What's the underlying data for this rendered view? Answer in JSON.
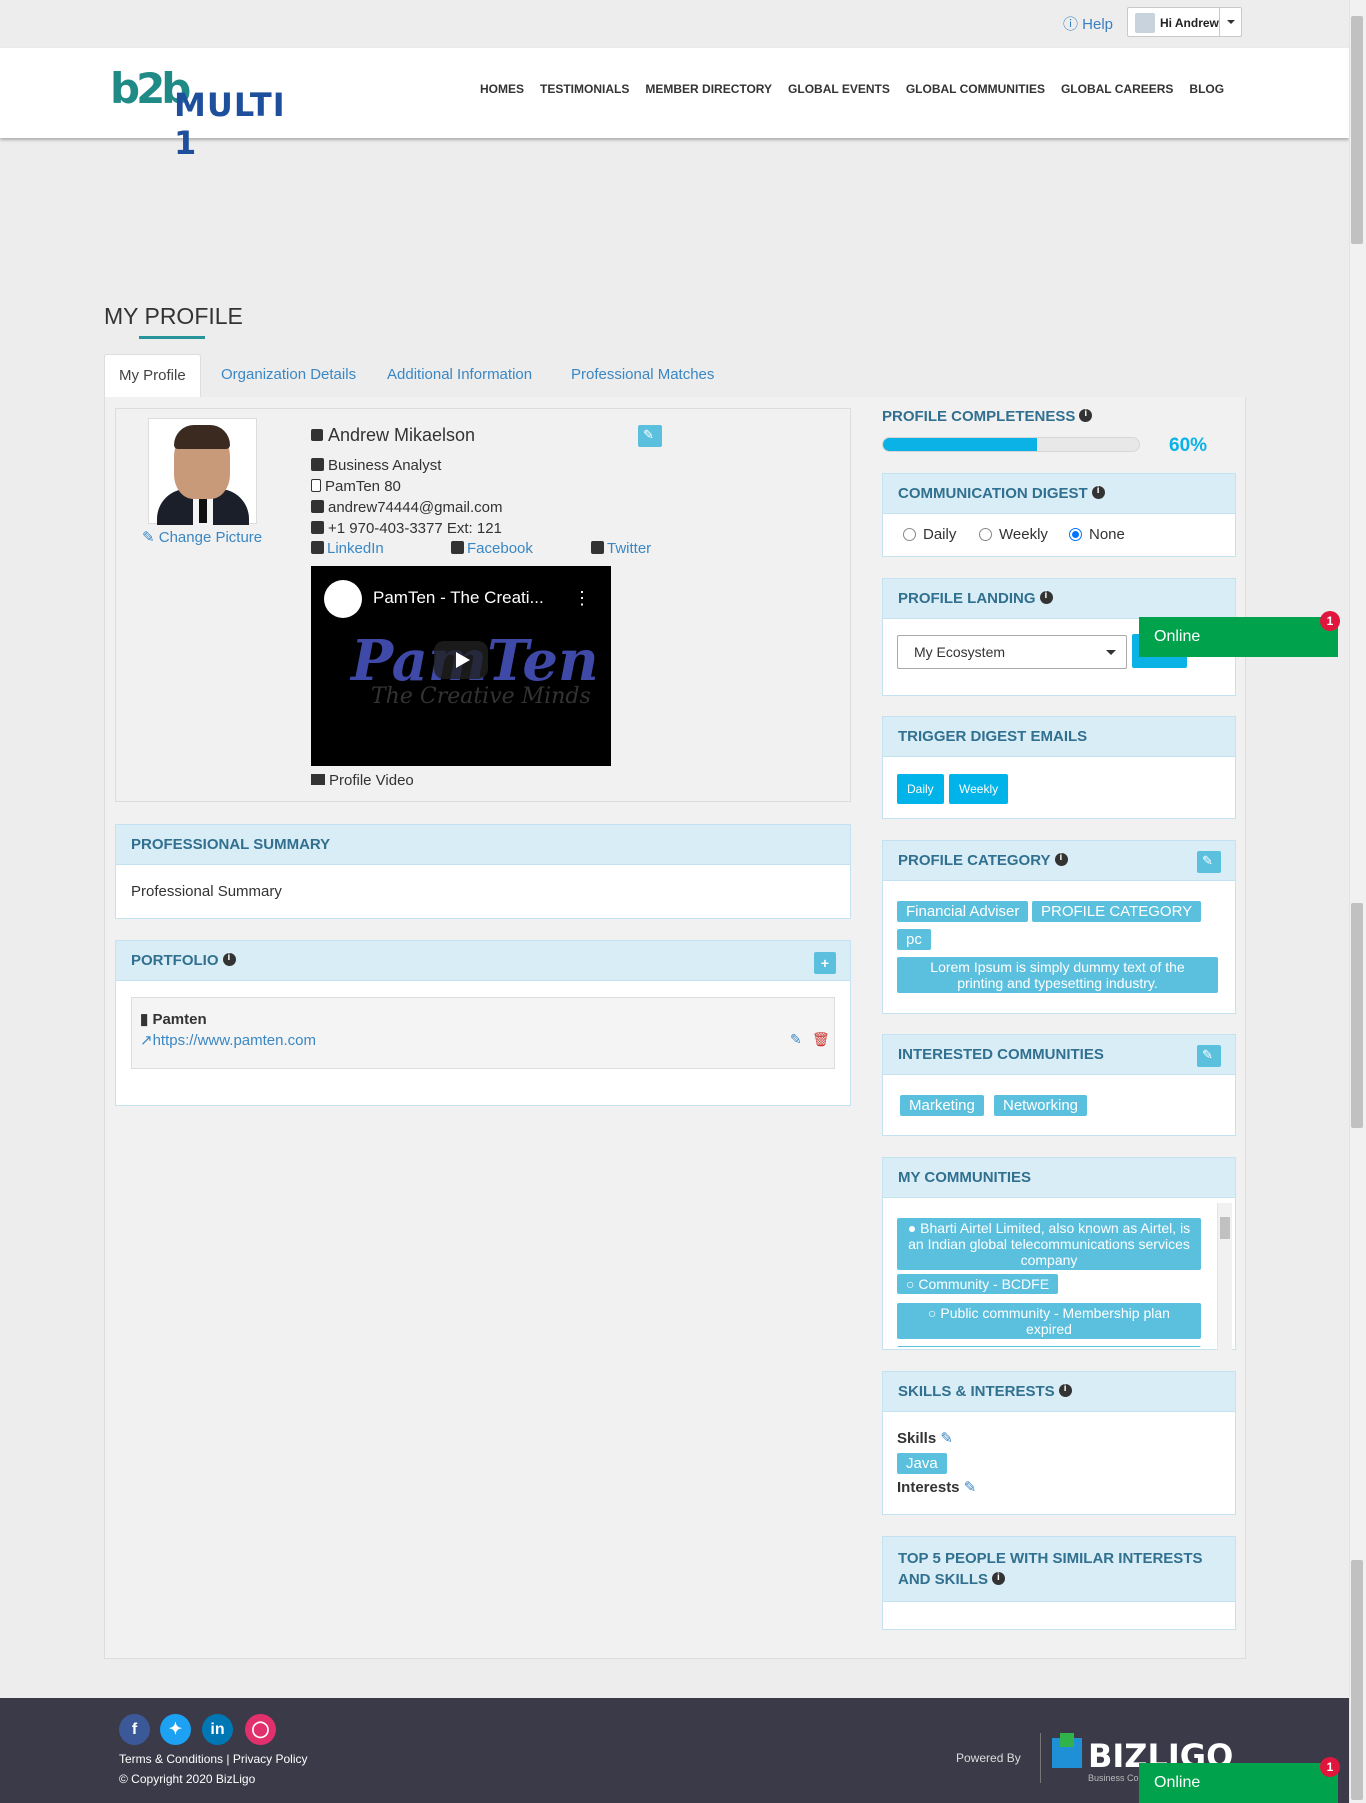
{
  "topbar": {
    "help": "Help",
    "user_greeting": "Hi Andrew"
  },
  "header": {
    "logo_mark": "b2b",
    "logo_text": "MULTI 1",
    "nav": [
      "HOMES",
      "TESTIMONIALS",
      "MEMBER DIRECTORY",
      "GLOBAL EVENTS",
      "GLOBAL COMMUNITIES",
      "GLOBAL CAREERS",
      "BLOG"
    ]
  },
  "page": {
    "title": "MY PROFILE"
  },
  "tabs": [
    "My Profile",
    "Organization Details",
    "Additional Information",
    "Professional Matches"
  ],
  "profile": {
    "name": "Andrew Mikaelson",
    "change_picture": "Change Picture",
    "job_title": "Business Analyst",
    "organization": "PamTen 80",
    "email": "andrew74444@gmail.com",
    "phone": "+1 970-403-3377 Ext: 121",
    "linkedin": "LinkedIn",
    "facebook": "Facebook",
    "twitter": "Twitter",
    "video_title": "PamTen - The Creati...",
    "video_big": "PamTen",
    "video_sub": "The Creative Minds",
    "profile_video": "Profile Video"
  },
  "professional_summary": {
    "title": "PROFESSIONAL SUMMARY",
    "body": "Professional Summary"
  },
  "portfolio": {
    "title": "PORTFOLIO",
    "item_name": "Pamten",
    "item_url": "https://www.pamten.com"
  },
  "completeness": {
    "title": "PROFILE COMPLETENESS",
    "percent_label": "60%",
    "percent": 0.6
  },
  "communication_digest": {
    "title": "COMMUNICATION DIGEST",
    "options": [
      "Daily",
      "Weekly",
      "None"
    ],
    "selected": "None"
  },
  "profile_landing": {
    "title": "PROFILE LANDING",
    "selected": "My Ecosystem"
  },
  "trigger_digest": {
    "title": "TRIGGER DIGEST EMAILS",
    "buttons": [
      "Daily",
      "Weekly"
    ]
  },
  "profile_category": {
    "title": "PROFILE CATEGORY",
    "tags": [
      "Financial Adviser",
      "PROFILE CATEGORY",
      "pc",
      "Lorem Ipsum is simply dummy text of the printing and typesetting industry."
    ]
  },
  "interested_communities": {
    "title": "INTERESTED COMMUNITIES",
    "tags": [
      "Marketing",
      "Networking"
    ]
  },
  "my_communities": {
    "title": "MY COMMUNITIES",
    "items": [
      "Bharti Airtel Limited, also known as Airtel, is an Indian global telecommunications services company",
      "Community - BCDFE",
      "Public community - Membership plan expired"
    ]
  },
  "skills_interests": {
    "title": "SKILLS & INTERESTS",
    "skills_label": "Skills",
    "skills": [
      "Java"
    ],
    "interests_label": "Interests"
  },
  "top5": {
    "title": "TOP 5 PEOPLE WITH SIMILAR INTERESTS AND SKILLS"
  },
  "online_widget": {
    "label": "Online",
    "badge": "1"
  },
  "footer": {
    "terms": "Terms & Conditions | Privacy Policy",
    "copyright": "© Copyright 2020 BizLigo",
    "powered_by": "Powered By",
    "brand": "BIZLIGO",
    "brand_sub": "Business Co"
  },
  "colors": {
    "accent": "#5bc0de",
    "panel_header": "#d9edf7",
    "panel_title": "#31708f",
    "online": "#00a34b",
    "progress": "#0ab2e6",
    "footer": "#3a3a48"
  }
}
